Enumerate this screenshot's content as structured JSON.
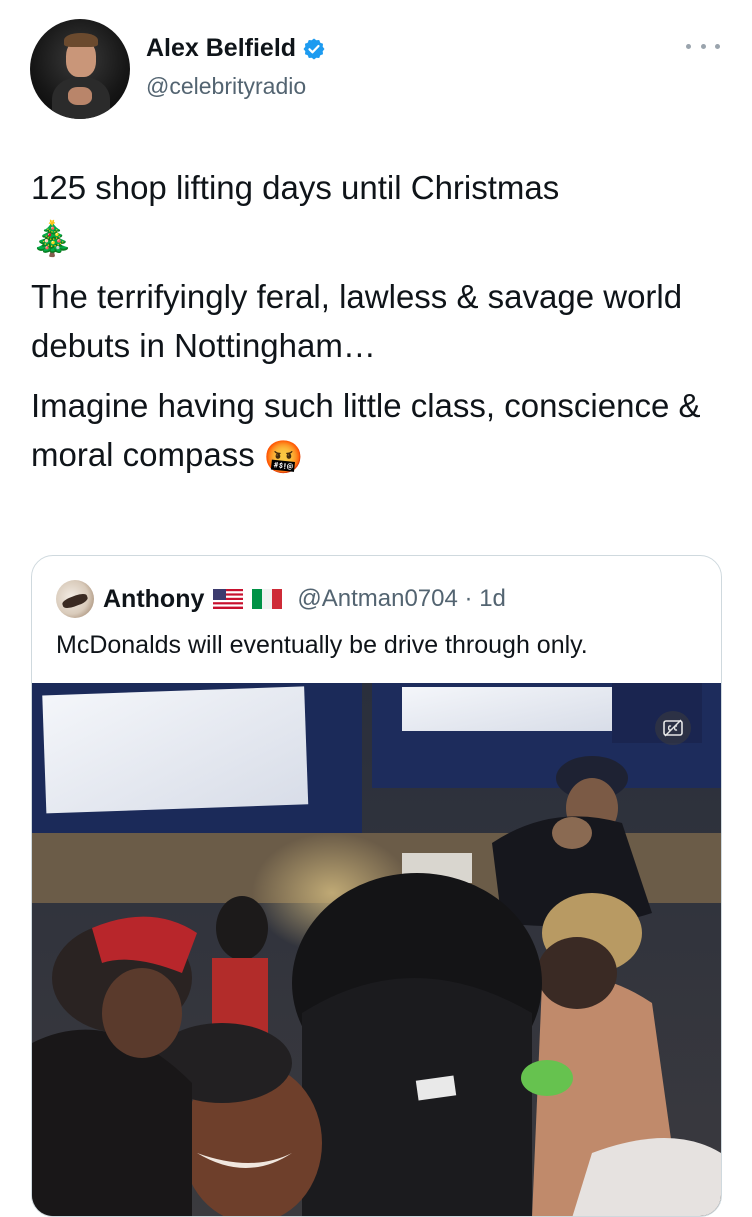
{
  "author": {
    "display_name": "Alex Belfield",
    "handle": "@celebrityradio",
    "verified": true,
    "avatar_icon": "profile-photo"
  },
  "tweet": {
    "paragraph_1": "125 shop lifting days until Christmas",
    "paragraph_1_emoji": "🎄",
    "paragraph_2": "The terrifyingly feral, lawless & savage world debuts in Nottingham…",
    "paragraph_3": "Imagine having such little class, conscience & moral compass",
    "paragraph_3_emoji": "🤬"
  },
  "quoted_tweet": {
    "name": "Anthony",
    "flags": [
      "us-flag-icon",
      "italy-flag-icon"
    ],
    "handle": "@Antman0704",
    "separator": "·",
    "time": "1d",
    "text": "McDonalds will eventually be drive through only.",
    "media": {
      "type": "video",
      "cc_icon": "closed-captions-icon"
    }
  },
  "colors": {
    "text": "#0f1419",
    "secondary": "#536471",
    "verified_blue": "#1d9bf0",
    "border": "#cfd9de"
  }
}
